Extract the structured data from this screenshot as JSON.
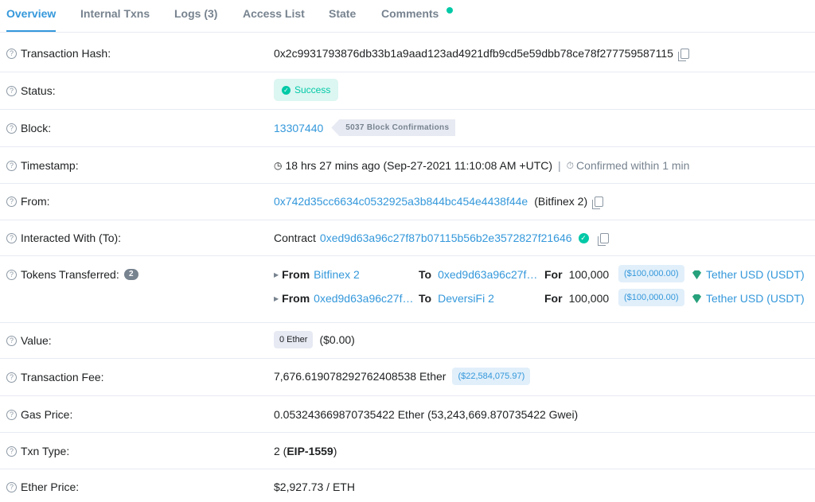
{
  "tabs": [
    {
      "label": "Overview"
    },
    {
      "label": "Internal Txns"
    },
    {
      "label": "Logs (3)"
    },
    {
      "label": "Access List"
    },
    {
      "label": "State"
    },
    {
      "label": "Comments"
    }
  ],
  "colors": {
    "accent": "#3498db",
    "success": "#00c9a7",
    "text": "#1e2022",
    "muted": "#77838f"
  },
  "rows": {
    "hash": {
      "label": "Transaction Hash:",
      "value": "0x2c9931793876db33b1a9aad123ad4921dfb9cd5e59dbb78ce78f277759587115"
    },
    "status": {
      "label": "Status:",
      "value": "Success"
    },
    "block": {
      "label": "Block:",
      "value": "13307440",
      "confirmations": "5037 Block Confirmations"
    },
    "timestamp": {
      "label": "Timestamp:",
      "value": "18 hrs 27 mins ago (Sep-27-2021 11:10:08 AM +UTC)",
      "sep": "|",
      "confirmed": "Confirmed within 1 min"
    },
    "from": {
      "label": "From:",
      "address": "0x742d35cc6634c0532925a3b844bc454e4438f44e",
      "name": "(Bitfinex 2)"
    },
    "to": {
      "label": "Interacted With (To):",
      "prefix": "Contract",
      "address": "0xed9d63a96c27f87b07115b56b2e3572827f21646"
    },
    "tokens": {
      "label": "Tokens Transferred:",
      "count": "2",
      "transfers": [
        {
          "from_label": "From",
          "from": "Bitfinex 2",
          "to_label": "To",
          "to": "0xed9d63a96c27f…",
          "for_label": "For",
          "amount": "100,000",
          "usd": "($100,000.00)",
          "token": "Tether USD (USDT)"
        },
        {
          "from_label": "From",
          "from": "0xed9d63a96c27f…",
          "to_label": "To",
          "to": "DeversiFi 2",
          "for_label": "For",
          "amount": "100,000",
          "usd": "($100,000.00)",
          "token": "Tether USD (USDT)"
        }
      ]
    },
    "value": {
      "label": "Value:",
      "pill": "0 Ether",
      "usd": "($0.00)"
    },
    "fee": {
      "label": "Transaction Fee:",
      "value": "7,676.619078292762408538 Ether",
      "usd": "($22,584,075.97)"
    },
    "gas": {
      "label": "Gas Price:",
      "value": "0.053243669870735422 Ether (53,243,669.870735422 Gwei)"
    },
    "type": {
      "label": "Txn Type:",
      "num": "2 (",
      "kind": "EIP-1559",
      "close": ")"
    },
    "price": {
      "label": "Ether Price:",
      "value": "$2,927.73 / ETH"
    }
  }
}
